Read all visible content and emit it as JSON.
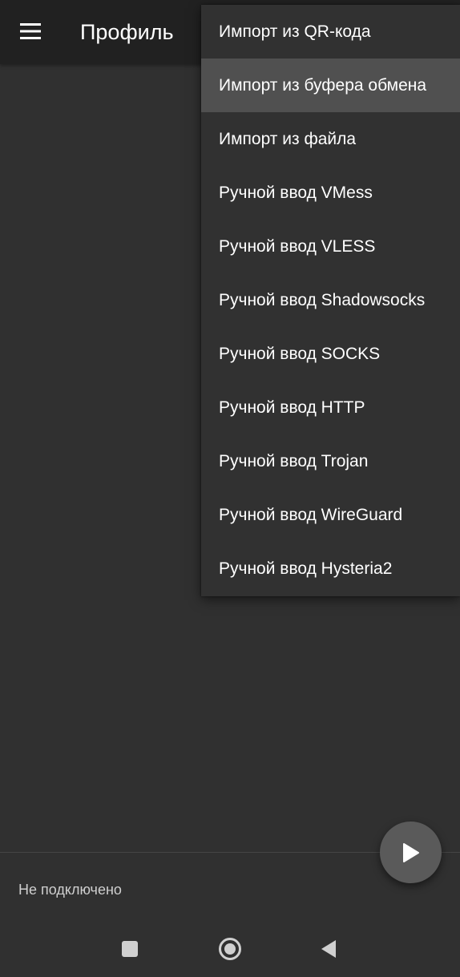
{
  "app_bar": {
    "title": "Профиль",
    "menu_icon": "hamburger-menu-icon"
  },
  "dropdown": {
    "items": [
      {
        "label": "Импорт из QR-кода"
      },
      {
        "label": "Импорт из буфера обмена",
        "highlighted": true
      },
      {
        "label": "Импорт из файла"
      },
      {
        "label": "Ручной ввод VMess"
      },
      {
        "label": "Ручной ввод VLESS"
      },
      {
        "label": "Ручной ввод Shadowsocks"
      },
      {
        "label": "Ручной ввод SOCKS"
      },
      {
        "label": "Ручной ввод HTTP"
      },
      {
        "label": "Ручной ввод Trojan"
      },
      {
        "label": "Ручной ввод WireGuard"
      },
      {
        "label": "Ручной ввод Hysteria2"
      }
    ]
  },
  "status": {
    "text": "Не подключено"
  },
  "fab": {
    "icon": "play-icon"
  },
  "nav_bar": {
    "recents_icon": "recents-square-icon",
    "home_icon": "home-circle-icon",
    "back_icon": "back-triangle-icon"
  },
  "colors": {
    "background": "#303030",
    "app_bar": "#212121",
    "menu_background": "#313131",
    "menu_highlight": "#505050",
    "fab": "#5a5a5a",
    "text": "#ffffff",
    "status_text": "#cfcfcf"
  }
}
